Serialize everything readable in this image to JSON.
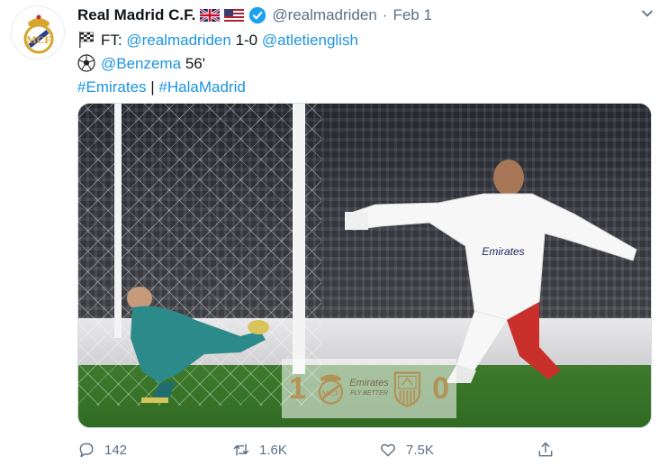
{
  "tweet": {
    "author_name": "Real Madrid C.F.",
    "handle": "@realmadriden",
    "separator": "·",
    "time": "Feb 1",
    "line1_prefix": "FT:",
    "line1_mention1": "@realmadriden",
    "line1_score": "1-0",
    "line1_mention2": "@atletienglish",
    "line2_mention": "@Benzema",
    "line2_minute": "56'",
    "hashtag1": "#Emirates",
    "hashtag_sep": "|",
    "hashtag2": "#HalaMadrid"
  },
  "media": {
    "score_home": "1",
    "score_away": "0",
    "sponsor": "Emirates",
    "sponsor_tagline": "FLY BETTER"
  },
  "actions": {
    "replies": "142",
    "retweets": "1.6K",
    "likes": "7.5K"
  },
  "colors": {
    "link": "#1b95e0",
    "secondary_text": "#5b7083",
    "verified": "#1da1f2"
  }
}
